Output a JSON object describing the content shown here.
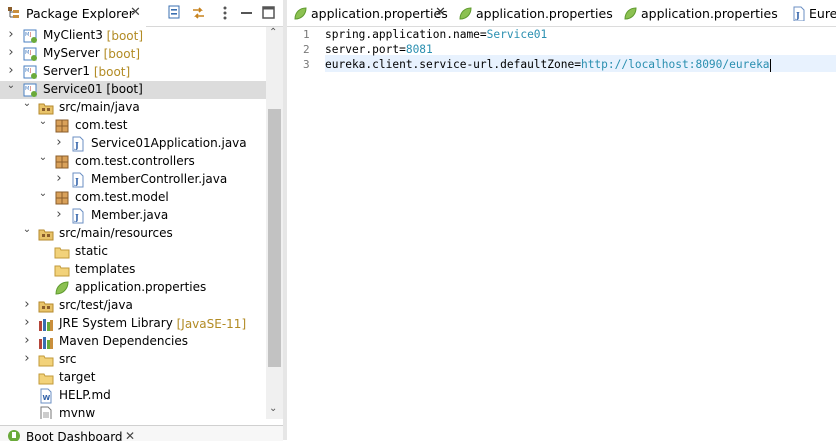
{
  "package_explorer": {
    "title": "Package Explorer",
    "close": "✕"
  },
  "tree": [
    {
      "label": "MyClient3",
      "decoration": "[boot]",
      "icon": "boot-project-icon",
      "arrow": "collapsed"
    },
    {
      "label": "MyServer",
      "decoration": "[boot]",
      "icon": "boot-project-icon",
      "arrow": "collapsed"
    },
    {
      "label": "Server1",
      "decoration": "[boot]",
      "icon": "boot-project-icon",
      "arrow": "collapsed"
    },
    {
      "label": "Service01 [boot]",
      "decoration": "",
      "icon": "boot-project-icon",
      "arrow": "expanded",
      "selected": true
    },
    {
      "label": "src/main/java",
      "decoration": "",
      "icon": "source-folder-icon",
      "arrow": "expanded"
    },
    {
      "label": "com.test",
      "decoration": "",
      "icon": "package-icon",
      "arrow": "expanded"
    },
    {
      "label": "Service01Application.java",
      "decoration": "",
      "icon": "java-file-icon",
      "arrow": "collapsed"
    },
    {
      "label": "com.test.controllers",
      "decoration": "",
      "icon": "package-icon",
      "arrow": "expanded"
    },
    {
      "label": "MemberController.java",
      "decoration": "",
      "icon": "java-file-icon",
      "arrow": "collapsed"
    },
    {
      "label": "com.test.model",
      "decoration": "",
      "icon": "package-icon",
      "arrow": "expanded"
    },
    {
      "label": "Member.java",
      "decoration": "",
      "icon": "java-file-icon",
      "arrow": "collapsed"
    },
    {
      "label": "src/main/resources",
      "decoration": "",
      "icon": "source-folder-icon",
      "arrow": "expanded"
    },
    {
      "label": "static",
      "decoration": "",
      "icon": "folder-icon",
      "arrow": "none"
    },
    {
      "label": "templates",
      "decoration": "",
      "icon": "folder-icon",
      "arrow": "none"
    },
    {
      "label": "application.properties",
      "decoration": "",
      "icon": "spring-leaf-icon",
      "arrow": "none"
    },
    {
      "label": "src/test/java",
      "decoration": "",
      "icon": "source-folder-icon",
      "arrow": "collapsed"
    },
    {
      "label": "JRE System Library",
      "decoration": "[JavaSE-11]",
      "icon": "library-icon",
      "arrow": "collapsed"
    },
    {
      "label": "Maven Dependencies",
      "decoration": "",
      "icon": "library-icon",
      "arrow": "collapsed"
    },
    {
      "label": "src",
      "decoration": "",
      "icon": "folder-icon",
      "arrow": "collapsed"
    },
    {
      "label": "target",
      "decoration": "",
      "icon": "folder-icon",
      "arrow": "none"
    },
    {
      "label": "HELP.md",
      "decoration": "",
      "icon": "markdown-file-icon",
      "arrow": "none"
    },
    {
      "label": "mvnw",
      "decoration": "",
      "icon": "text-file-icon",
      "arrow": "none"
    }
  ],
  "bottom_panel": {
    "title": "Boot Dashboard",
    "close": "✕"
  },
  "editor_tabs": [
    {
      "label": "application.properties",
      "active": true,
      "close": "✕"
    },
    {
      "label": "application.properties",
      "active": false
    },
    {
      "label": "application.properties",
      "active": false
    },
    {
      "label": "Eurek",
      "active": false
    }
  ],
  "editor": {
    "lines": [
      {
        "num": "1",
        "key": "spring.application.name=",
        "value": "Service01"
      },
      {
        "num": "2",
        "key": "server.port=",
        "value": "8081"
      },
      {
        "num": "3",
        "key": "eureka.client.service-url.defaultZone=",
        "value": "http://localhost:8090/eureka"
      }
    ]
  },
  "colors": {
    "selection": "#dcdcdc",
    "value_text": "#2a8fb0",
    "boot_decoration": "#b28b24"
  }
}
